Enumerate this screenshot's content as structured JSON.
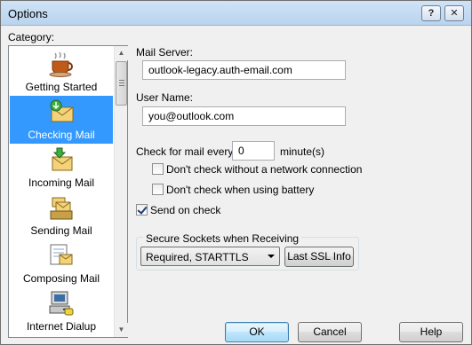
{
  "window": {
    "title": "Options",
    "help_glyph": "?",
    "close_glyph": "✕"
  },
  "category": {
    "label": "Category:",
    "items": [
      {
        "label": "Getting Started",
        "icon": "coffee-cup-icon"
      },
      {
        "label": "Checking Mail",
        "icon": "mail-download-icon",
        "selected": true
      },
      {
        "label": "Incoming Mail",
        "icon": "inbox-icon"
      },
      {
        "label": "Sending Mail",
        "icon": "outbox-icon"
      },
      {
        "label": "Composing Mail",
        "icon": "compose-icon"
      },
      {
        "label": "Internet Dialup",
        "icon": "dialup-computer-icon"
      }
    ]
  },
  "form": {
    "mail_server_label": "Mail Server:",
    "mail_server_value": "outlook-legacy.auth-email.com",
    "user_name_label": "User Name:",
    "user_name_value": "you@outlook.com",
    "check_every_label": "Check for mail every",
    "check_every_value": "0",
    "minutes_label": "minute(s)",
    "no_network_label": "Don't check without a network connection",
    "no_network_checked": false,
    "battery_label": "Don't check when using battery",
    "battery_checked": false,
    "send_on_check_label": "Send on check",
    "send_on_check_checked": true
  },
  "ssl": {
    "group_title": "Secure Sockets when Receiving",
    "selected_option": "Required, STARTTLS",
    "info_button": "Last SSL Info"
  },
  "footer": {
    "ok": "OK",
    "cancel": "Cancel",
    "help": "Help"
  }
}
